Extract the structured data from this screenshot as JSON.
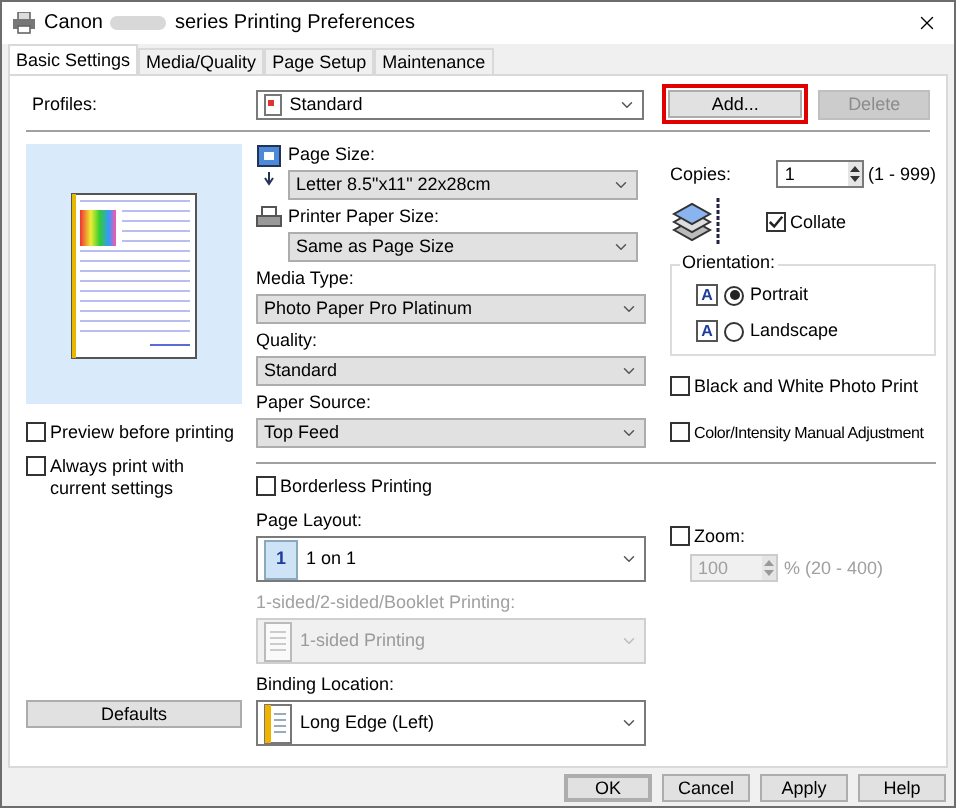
{
  "window": {
    "title_prefix": "Canon",
    "title_suffix": "series Printing Preferences"
  },
  "tabs": [
    {
      "label": "Basic Settings",
      "selected": true
    },
    {
      "label": "Media/Quality",
      "selected": false
    },
    {
      "label": "Page Setup",
      "selected": false
    },
    {
      "label": "Maintenance",
      "selected": false
    }
  ],
  "profiles": {
    "label": "Profiles:",
    "value": "Standard",
    "add": "Add...",
    "add_highlighted": true,
    "delete": "Delete",
    "delete_disabled": true
  },
  "preview_options": [
    {
      "label": "Preview before printing",
      "checked": false
    },
    {
      "label": "Always print with current settings",
      "checked": false
    }
  ],
  "defaults_button": "Defaults",
  "page_size": {
    "label": "Page Size:",
    "value": "Letter 8.5\"x11\" 22x28cm"
  },
  "printer_paper_size": {
    "label": "Printer Paper Size:",
    "value": "Same as Page Size"
  },
  "media_type": {
    "label": "Media Type:",
    "value": "Photo Paper Pro Platinum"
  },
  "quality": {
    "label": "Quality:",
    "value": "Standard"
  },
  "paper_source": {
    "label": "Paper Source:",
    "value": "Top Feed"
  },
  "copies": {
    "label": "Copies:",
    "value": "1",
    "range": "(1 - 999)"
  },
  "collate": {
    "label": "Collate",
    "checked": true
  },
  "orientation": {
    "label": "Orientation:",
    "options": [
      {
        "label": "Portrait",
        "selected": true,
        "icon_text": "A"
      },
      {
        "label": "Landscape",
        "selected": false,
        "icon_text": "A"
      }
    ]
  },
  "color_options": [
    {
      "label": "Black and White Photo Print",
      "checked": false
    },
    {
      "label": "Color/Intensity Manual Adjustment",
      "checked": false
    }
  ],
  "borderless": {
    "label": "Borderless Printing",
    "checked": false
  },
  "page_layout": {
    "label": "Page Layout:",
    "value": "1 on 1",
    "icon_text": "1"
  },
  "duplex": {
    "label": "1-sided/2-sided/Booklet Printing:",
    "value": "1-sided Printing",
    "disabled": true
  },
  "binding": {
    "label": "Binding Location:",
    "value": "Long Edge (Left)"
  },
  "zoom": {
    "label": "Zoom:",
    "checked": false,
    "value": "100",
    "range": "% (20 - 400)",
    "disabled": true
  },
  "buttons": [
    {
      "label": "OK",
      "default": true
    },
    {
      "label": "Cancel",
      "default": false
    },
    {
      "label": "Apply",
      "default": false
    },
    {
      "label": "Help",
      "default": false
    }
  ]
}
